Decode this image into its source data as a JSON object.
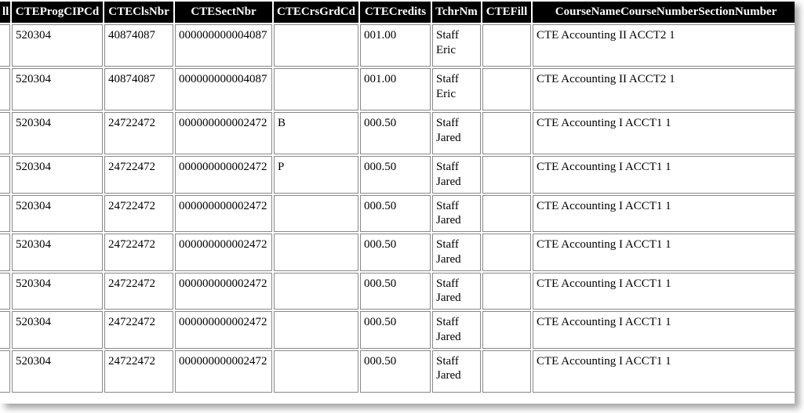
{
  "columns": [
    {
      "key": "fill0",
      "label": "ll"
    },
    {
      "key": "cip",
      "label": "CTEProgCIPCd"
    },
    {
      "key": "clsnbr",
      "label": "CTEClsNbr"
    },
    {
      "key": "sectnbr",
      "label": "CTESectNbr"
    },
    {
      "key": "grdcd",
      "label": "CTECrsGrdCd"
    },
    {
      "key": "credits",
      "label": "CTECredits"
    },
    {
      "key": "tchr",
      "label": "TchrNm"
    },
    {
      "key": "ctefill",
      "label": "CTEFill"
    },
    {
      "key": "course",
      "label": "CourseNameCourseNumberSectionNumber"
    }
  ],
  "rows": [
    {
      "fill0": "",
      "cip": "520304",
      "clsnbr": "40874087",
      "sectnbr": "000000000004087",
      "grdcd": "",
      "credits": "001.00",
      "tchr": "Staff Eric",
      "ctefill": "",
      "course": "CTE Accounting II ACCT2 1",
      "h": "tall"
    },
    {
      "fill0": "",
      "cip": "520304",
      "clsnbr": "40874087",
      "sectnbr": "000000000004087",
      "grdcd": "",
      "credits": "001.00",
      "tchr": "Staff Eric",
      "ctefill": "",
      "course": "CTE Accounting II ACCT2 1",
      "h": "tall"
    },
    {
      "fill0": "",
      "cip": "520304",
      "clsnbr": "24722472",
      "sectnbr": "000000000002472",
      "grdcd": "B",
      "credits": "000.50",
      "tchr": "Staff Jared",
      "ctefill": "",
      "course": "CTE Accounting I ACCT1 1",
      "h": "tall"
    },
    {
      "fill0": "",
      "cip": "520304",
      "clsnbr": "24722472",
      "sectnbr": "000000000002472",
      "grdcd": "P",
      "credits": "000.50",
      "tchr": "Staff Jared",
      "ctefill": "",
      "course": "CTE Accounting I ACCT1 1",
      "h": "short"
    },
    {
      "fill0": "",
      "cip": "520304",
      "clsnbr": "24722472",
      "sectnbr": "000000000002472",
      "grdcd": "",
      "credits": "000.50",
      "tchr": "Staff Jared",
      "ctefill": "",
      "course": "CTE Accounting I ACCT1 1",
      "h": "short"
    },
    {
      "fill0": "",
      "cip": "520304",
      "clsnbr": "24722472",
      "sectnbr": "000000000002472",
      "grdcd": "",
      "credits": "000.50",
      "tchr": "Staff Jared",
      "ctefill": "",
      "course": "CTE Accounting I ACCT1 1",
      "h": "short"
    },
    {
      "fill0": "",
      "cip": "520304",
      "clsnbr": "24722472",
      "sectnbr": "000000000002472",
      "grdcd": "",
      "credits": "000.50",
      "tchr": "Staff Jared",
      "ctefill": "",
      "course": "CTE Accounting I ACCT1 1",
      "h": "short"
    },
    {
      "fill0": "",
      "cip": "520304",
      "clsnbr": "24722472",
      "sectnbr": "000000000002472",
      "grdcd": "",
      "credits": "000.50",
      "tchr": "Staff Jared",
      "ctefill": "",
      "course": "CTE Accounting I ACCT1 1",
      "h": "short"
    },
    {
      "fill0": "",
      "cip": "520304",
      "clsnbr": "24722472",
      "sectnbr": "000000000002472",
      "grdcd": "",
      "credits": "000.50",
      "tchr": "Staff Jared",
      "ctefill": "",
      "course": "CTE Accounting I ACCT1 1",
      "h": "tall"
    }
  ]
}
